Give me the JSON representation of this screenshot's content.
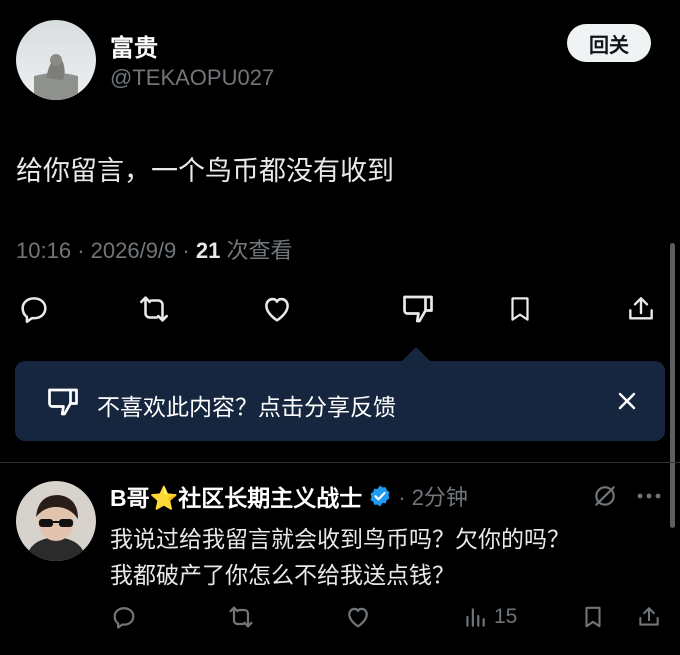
{
  "post": {
    "author_name": "富贵",
    "handle": "@TEKAOPU027",
    "follow_label": "回关",
    "text": "给你留言，一个鸟币都没有收到",
    "time": "10:16",
    "sep1": "·",
    "date": "2026/9/9",
    "sep2": "·",
    "views_count": "21",
    "views_label": "次查看"
  },
  "feedback": {
    "text": "不喜欢此内容？点击分享反馈"
  },
  "reply": {
    "author_name": "B哥⭐社区长期主义战士",
    "time": "· 2分钟",
    "text_line1": "我说过给我留言就会收到鸟币吗？欠你的吗？",
    "text_line2": "我都破产了你怎么不给我送点钱？",
    "views_count": "15"
  },
  "colors": {
    "background": "#000000",
    "accent": "#1d9bf0",
    "muted": "#71767b",
    "feedback_bg": "#16263f"
  },
  "icons": [
    "reply-icon",
    "repost-icon",
    "like-icon",
    "dislike-icon",
    "bookmark-icon",
    "share-icon",
    "close-icon",
    "verified-icon",
    "mute-icon",
    "more-icon",
    "views-icon"
  ]
}
